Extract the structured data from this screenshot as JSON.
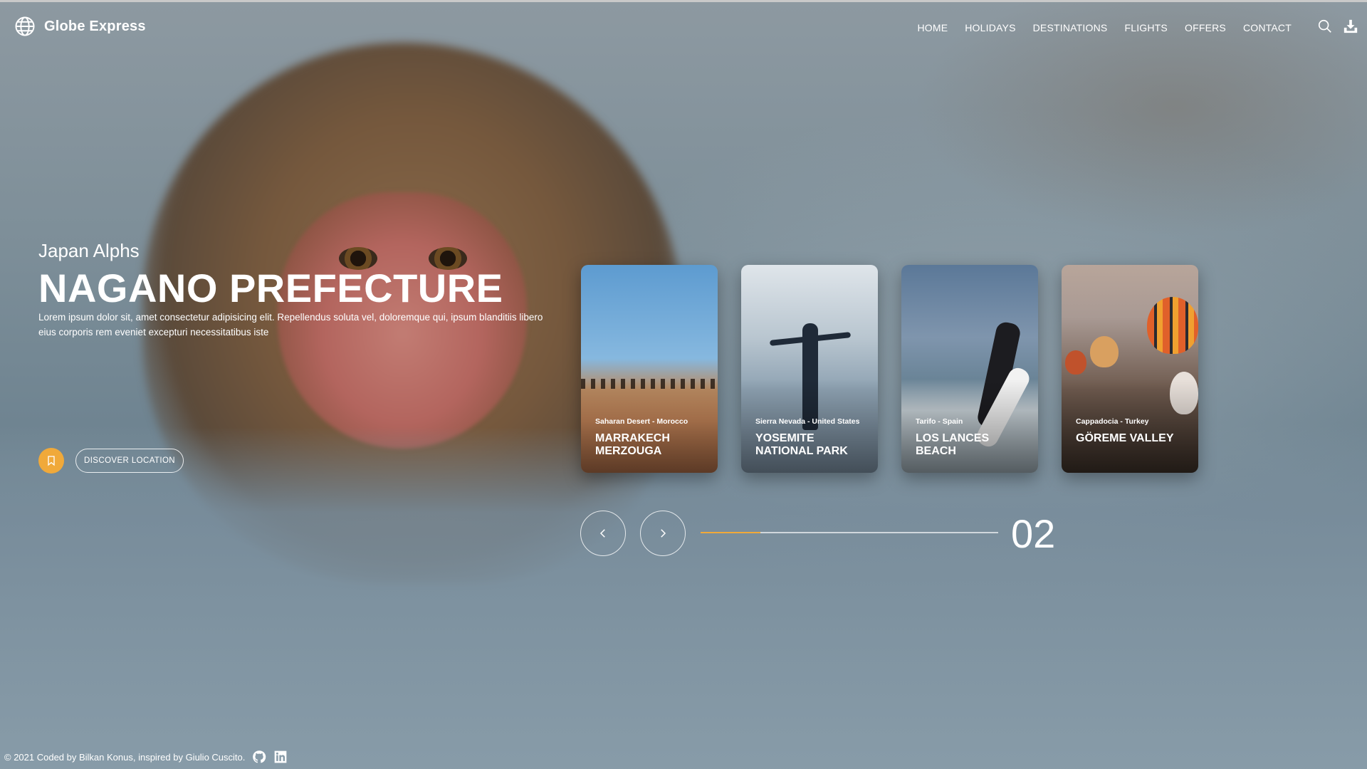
{
  "header": {
    "brand": "Globe Express",
    "nav": [
      "HOME",
      "HOLIDAYS",
      "DESTINATIONS",
      "FLIGHTS",
      "OFFERS",
      "CONTACT"
    ]
  },
  "hero": {
    "subtitle": "Japan Alphs",
    "title": "NAGANO PREFECTURE",
    "description": "Lorem ipsum dolor sit, amet consectetur adipisicing elit. Repellendus soluta vel, doloremque qui, ipsum blanditiis libero eius corporis rem eveniet excepturi necessitatibus iste",
    "discover_label": "DISCOVER LOCATION"
  },
  "cards": [
    {
      "location": "Saharan Desert - Morocco",
      "name": "MARRAKECH MERZOUGA"
    },
    {
      "location": "Sierra Nevada - United States",
      "name": "YOSEMITE NATIONAL PARK"
    },
    {
      "location": "Tarifo - Spain",
      "name": "LOS LANCES BEACH"
    },
    {
      "location": "Cappadocia - Turkey",
      "name": "GÖREME VALLEY"
    }
  ],
  "slider": {
    "counter": "02",
    "progress": 0.2
  },
  "footer": {
    "credit": "© 2021 Coded by Bilkan Konus, inspired by Giulio Cuscito."
  },
  "colors": {
    "accent": "#f0a93a"
  },
  "icons": {
    "logo": "globe-icon",
    "search": "search-icon",
    "download": "download-icon",
    "bookmark": "bookmark-icon",
    "prev": "chevron-left-icon",
    "next": "chevron-right-icon",
    "github": "github-icon",
    "linkedin": "linkedin-icon"
  }
}
